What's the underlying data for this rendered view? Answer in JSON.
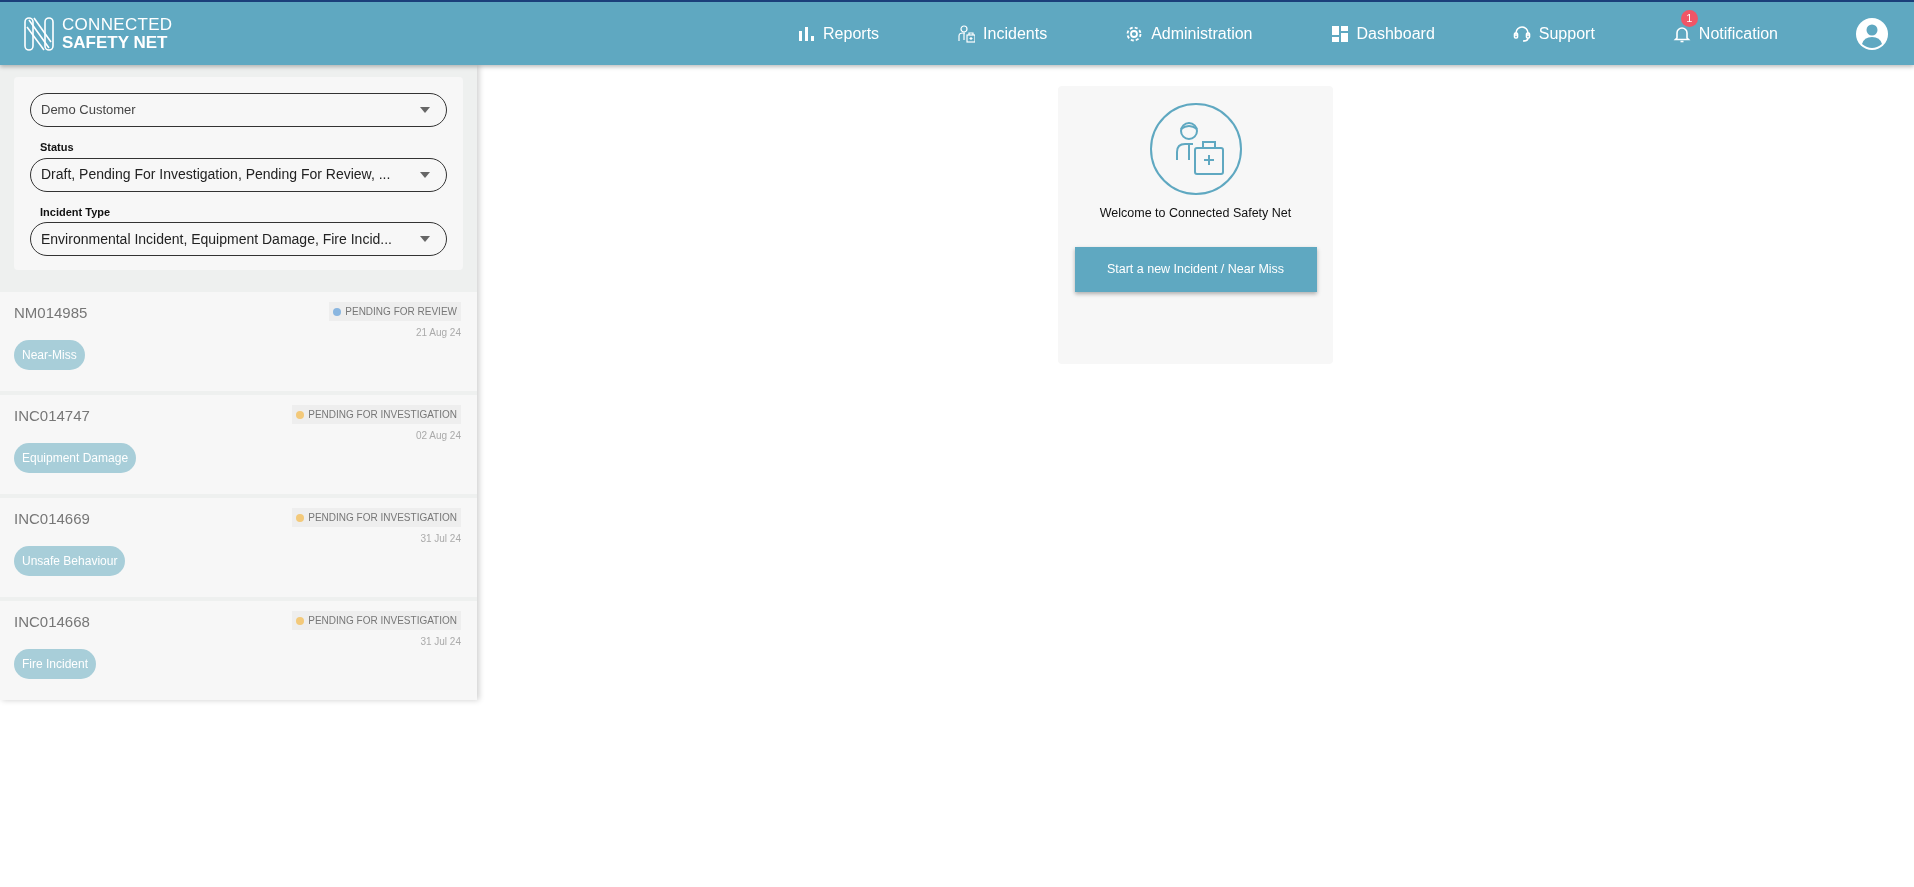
{
  "brand": {
    "line_1": "CONNECTED",
    "line_2": "SAFETY NET"
  },
  "nav": [
    {
      "kind": "chart",
      "label": "Reports"
    },
    {
      "kind": "incident",
      "label": "Incidents"
    },
    {
      "kind": "gear",
      "label": "Administration"
    },
    {
      "kind": "dashboard",
      "label": "Dashboard"
    },
    {
      "kind": "headset",
      "label": "Support"
    },
    {
      "kind": "bell",
      "label": "Notification",
      "badge": "1"
    }
  ],
  "filters": [
    {
      "value": "Demo Customer"
    },
    {
      "label": "Status",
      "value": "Draft, Pending For Investigation, Pending For Review, ..."
    },
    {
      "label": "Incident Type",
      "value": "Environmental Incident, Equipment Damage, Fire Incid..."
    }
  ],
  "incidents": [
    {
      "id": "NM014985",
      "status": "PENDING FOR REVIEW",
      "color": "#8ab6e0",
      "date": "21 Aug 24",
      "type": "Near-Miss"
    },
    {
      "id": "INC014747",
      "status": "PENDING FOR INVESTIGATION",
      "color": "#f3c97a",
      "date": "02 Aug 24",
      "type": "Equipment Damage"
    },
    {
      "id": "INC014669",
      "status": "PENDING FOR INVESTIGATION",
      "color": "#f3c97a",
      "date": "31 Jul 24",
      "type": "Unsafe Behaviour"
    },
    {
      "id": "INC014668",
      "status": "PENDING FOR INVESTIGATION",
      "color": "#f3c97a",
      "date": "31 Jul 24",
      "type": "Fire Incident"
    }
  ],
  "welcome": {
    "title": "Welcome to Connected Safety Net",
    "button": "Start a new Incident / Near Miss"
  }
}
